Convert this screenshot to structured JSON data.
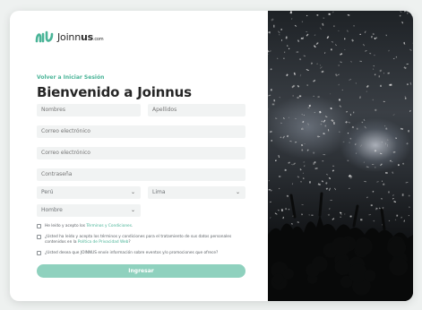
{
  "logo": {
    "text_regular": "Joinn",
    "text_bold": "us",
    "text_small": ".com"
  },
  "back_link": "Volver a Iniciar Sesión",
  "title": "Bienvenido a Joinnus",
  "fields": {
    "first_name_placeholder": "Nombres",
    "last_name_placeholder": "Apellidos",
    "email_placeholder": "Correo electrónico",
    "email_confirm_placeholder": "Correo electrónico",
    "password_placeholder": "Contraseña"
  },
  "selects": {
    "country": "Perú",
    "city": "Lima",
    "gender": "Hombre"
  },
  "checks": {
    "terms_prefix": "He leído y acepto los",
    "terms_link": "Términos y Condiciones",
    "terms_suffix": ".",
    "privacy_prefix": "¿Usted ha leído y acepta los términos y condiciones para el tratamiento de sus datos personales contenidos en la",
    "privacy_link": "Política de Privacidad Web",
    "privacy_suffix": "?",
    "promo_text": "¿Usted desea que JOINNUS envíe información sobre eventos y/o promociones que ofrece?"
  },
  "submit_label": "Ingresar",
  "colors": {
    "accent": "#49b497",
    "button": "#8fd1be",
    "field_bg": "#f1f3f3"
  },
  "icons": {
    "logo": "joinnus-logo-icon",
    "chevron": "chevron-down-icon"
  }
}
